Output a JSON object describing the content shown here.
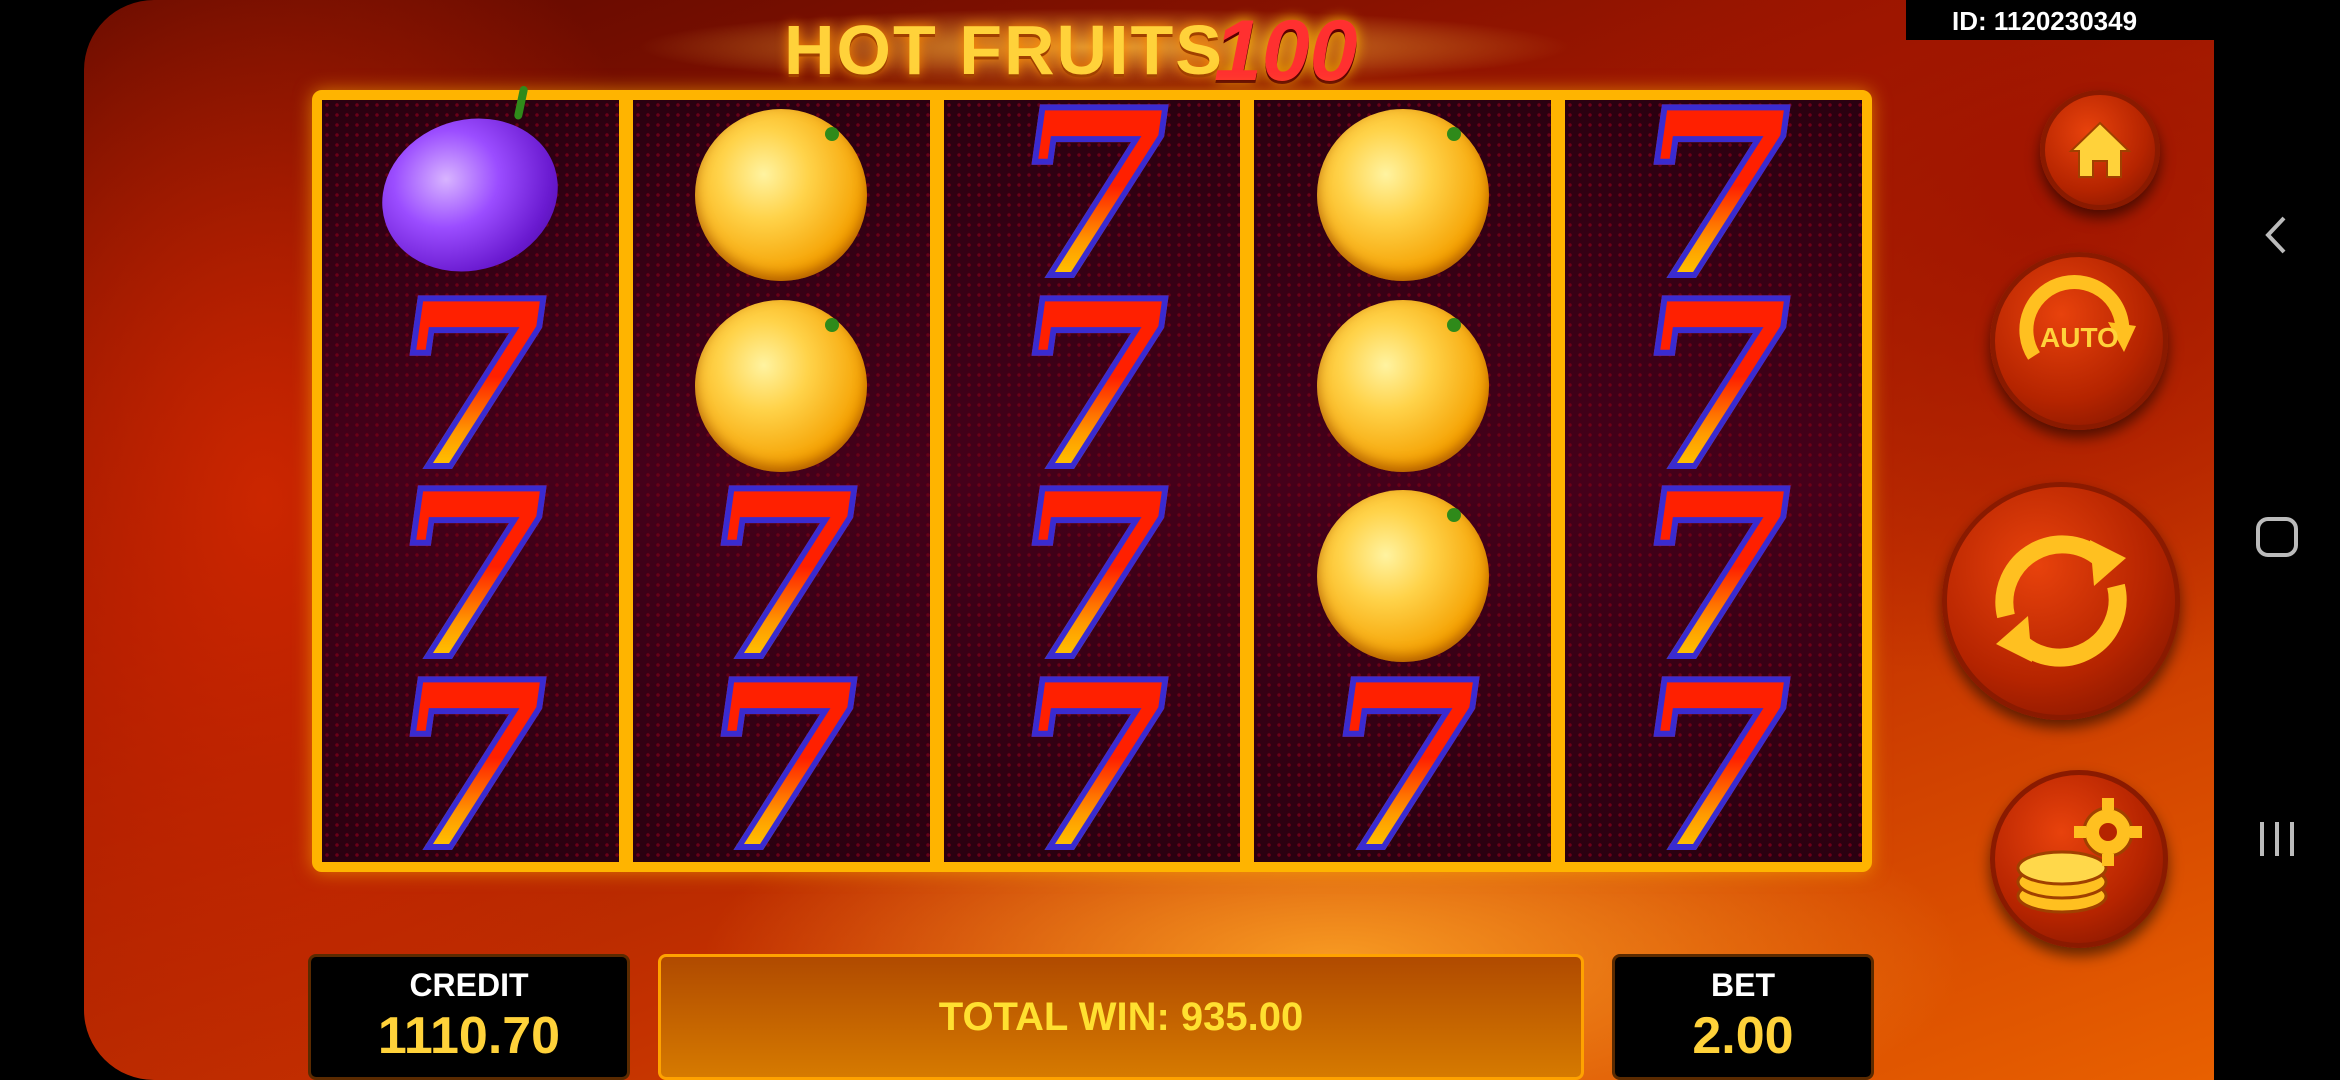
{
  "title": {
    "part1": "HOT FRUITS",
    "part2": "100"
  },
  "session_id": "ID: 1120230349",
  "reels": [
    [
      "plum",
      "seven",
      "seven",
      "seven"
    ],
    [
      "orange",
      "orange",
      "seven",
      "seven"
    ],
    [
      "seven",
      "seven",
      "seven",
      "seven"
    ],
    [
      "orange",
      "orange",
      "orange",
      "seven"
    ],
    [
      "seven",
      "seven",
      "seven",
      "seven"
    ]
  ],
  "symbols": {
    "seven": "7"
  },
  "controls": {
    "auto_label": "AUTO"
  },
  "credit": {
    "label": "CREDIT",
    "value": "1110.70"
  },
  "total_win": "TOTAL WIN: 935.00",
  "bet": {
    "label": "BET",
    "value": "2.00"
  },
  "navbar": {
    "back": "back-icon",
    "home": "home-nav-icon",
    "recents": "recents-icon"
  }
}
